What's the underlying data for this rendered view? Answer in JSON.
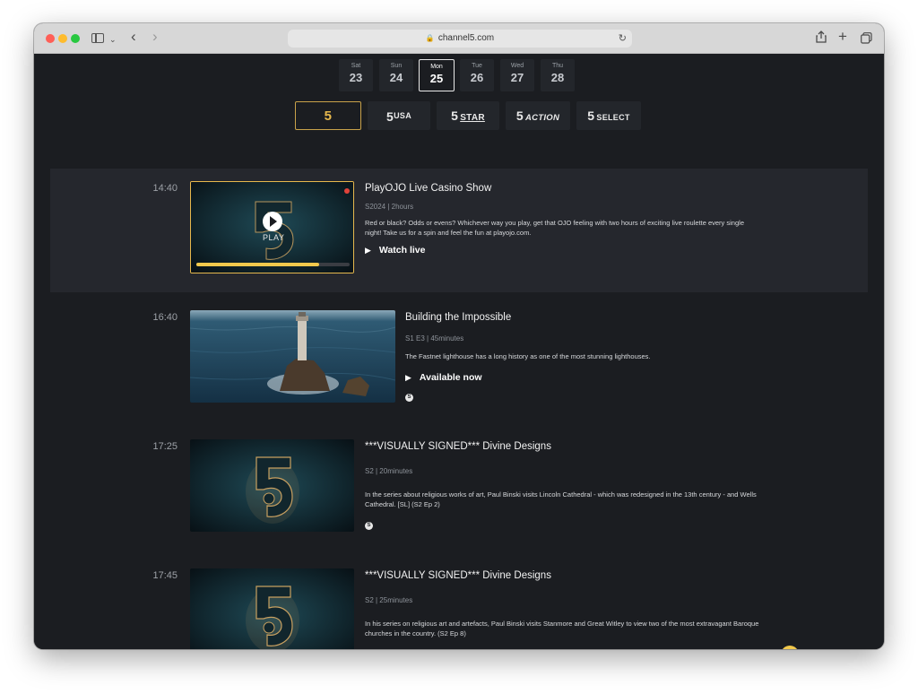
{
  "browser": {
    "url": "channel5.com"
  },
  "days": [
    {
      "name": "Sat",
      "date": "23",
      "active": false
    },
    {
      "name": "Sun",
      "date": "24",
      "active": false
    },
    {
      "name": "Mon",
      "date": "25",
      "active": true
    },
    {
      "name": "Tue",
      "date": "26",
      "active": false
    },
    {
      "name": "Wed",
      "date": "27",
      "active": false
    },
    {
      "name": "Thu",
      "date": "28",
      "active": false
    }
  ],
  "channels": [
    {
      "number": "5",
      "suffix": "",
      "active": true
    },
    {
      "number": "5",
      "suffix": "USA",
      "active": false
    },
    {
      "number": "5",
      "suffix": "STAR",
      "active": false
    },
    {
      "number": "5",
      "suffix": "ACTION",
      "active": false
    },
    {
      "number": "5",
      "suffix": "SELECT",
      "active": false
    }
  ],
  "schedule": [
    {
      "time": "14:40",
      "title": "PlayOJO Live Casino Show",
      "meta": "S2024 | 2hours",
      "description": "Red or black? Odds or evens? Whichever way you play, get that OJO feeling with two hours of exciting live roulette every single night! Take us for a spin and feel the fun at playojo.com.",
      "action": "Watch live",
      "play_label": "PLAY",
      "progress": 0.8,
      "live": true
    },
    {
      "time": "16:40",
      "title": "Building the Impossible",
      "meta": "S1 E3 | 45minutes",
      "description": "The Fastnet lighthouse has a long history as one of the most stunning lighthouses.",
      "action": "Available now",
      "subtitle_icon": "S"
    },
    {
      "time": "17:25",
      "title": "***VISUALLY SIGNED*** Divine Designs",
      "meta": "S2 | 20minutes",
      "description": "In the series about religious works of art, Paul Binski visits Lincoln Cathedral - which was redesigned in the 13th century - and Wells Cathedral. [SL] (S2 Ep 2)",
      "subtitle_icon": "S"
    },
    {
      "time": "17:45",
      "title": "***VISUALLY SIGNED*** Divine Designs",
      "meta": "S2 | 25minutes",
      "description": "In his series on religious art and artefacts, Paul Binski visits Stanmore and Great Witley to view two of the most extravagant Baroque churches in the country. (S2 Ep 8)",
      "subtitle_icon": "S"
    }
  ],
  "scroll_top_icon": "chevron-up-icon",
  "colors": {
    "page_bg": "#1b1d21",
    "live_row_bg": "#25272d",
    "accent_gold": "#e6b84d",
    "progress_gold": "#f2c94c"
  }
}
